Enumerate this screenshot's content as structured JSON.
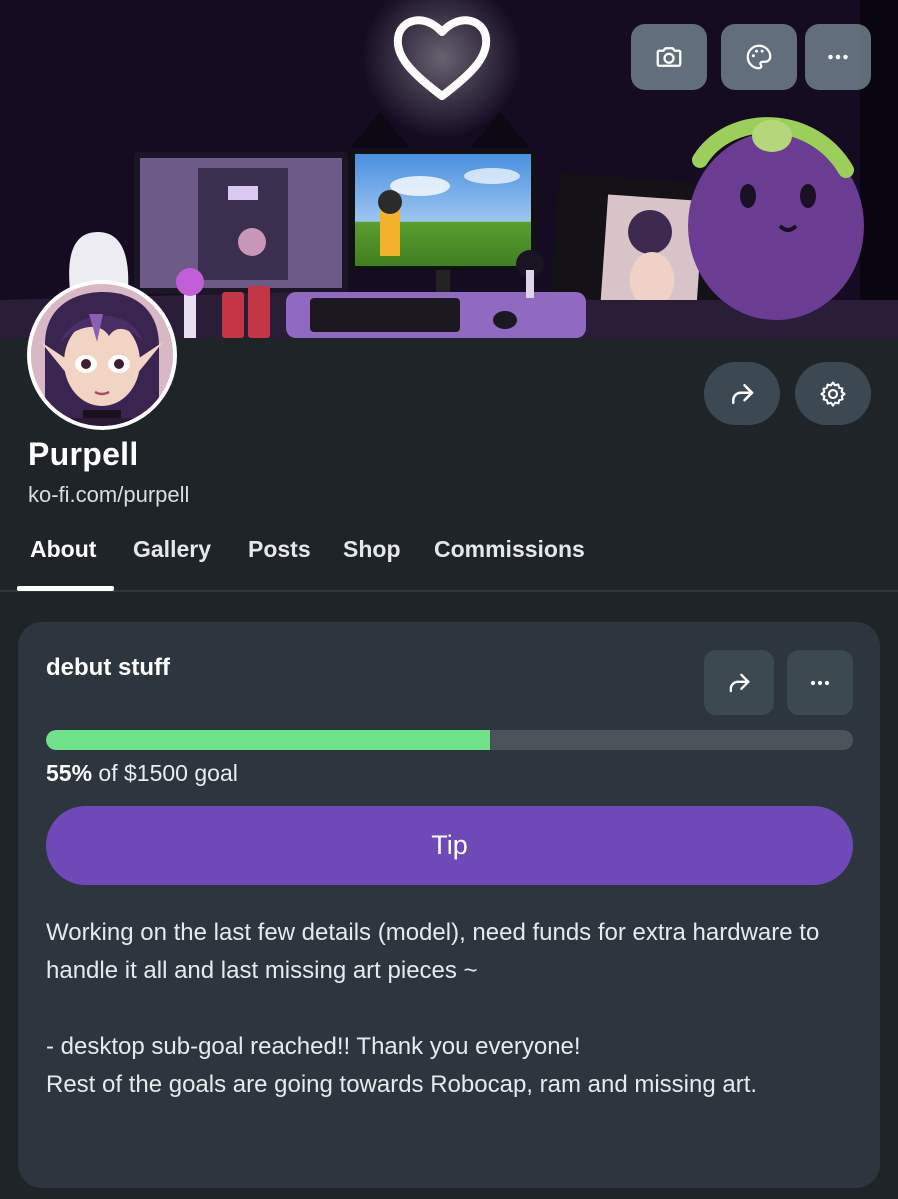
{
  "banner": {
    "top_buttons": [
      {
        "icon": "camera-icon"
      },
      {
        "icon": "palette-icon"
      },
      {
        "icon": "more-icon"
      }
    ]
  },
  "profile": {
    "name": "Purpell",
    "url": "ko-fi.com/purpell",
    "action_buttons": [
      {
        "icon": "share-icon"
      },
      {
        "icon": "gear-icon"
      }
    ]
  },
  "tabs": [
    {
      "label": "About",
      "active": true
    },
    {
      "label": "Gallery",
      "active": false
    },
    {
      "label": "Posts",
      "active": false
    },
    {
      "label": "Shop",
      "active": false
    },
    {
      "label": "Commissions",
      "active": false
    }
  ],
  "goal": {
    "title": "debut stuff",
    "progress_percent": 55,
    "progress_label": "55%",
    "progress_suffix": " of $1500 goal",
    "tip_label": "Tip",
    "description": [
      "Working on the last few details (model), need funds for extra hardware to handle it all and last missing art pieces ~",
      "- desktop sub-goal reached!! Thank you everyone!",
      "Rest of the goals are going towards Robocap, ram and missing art."
    ]
  },
  "colors": {
    "background": "#1f2428",
    "card": "#2d363e",
    "accent_purple": "#7049b8",
    "progress_green": "#6fe28a"
  }
}
